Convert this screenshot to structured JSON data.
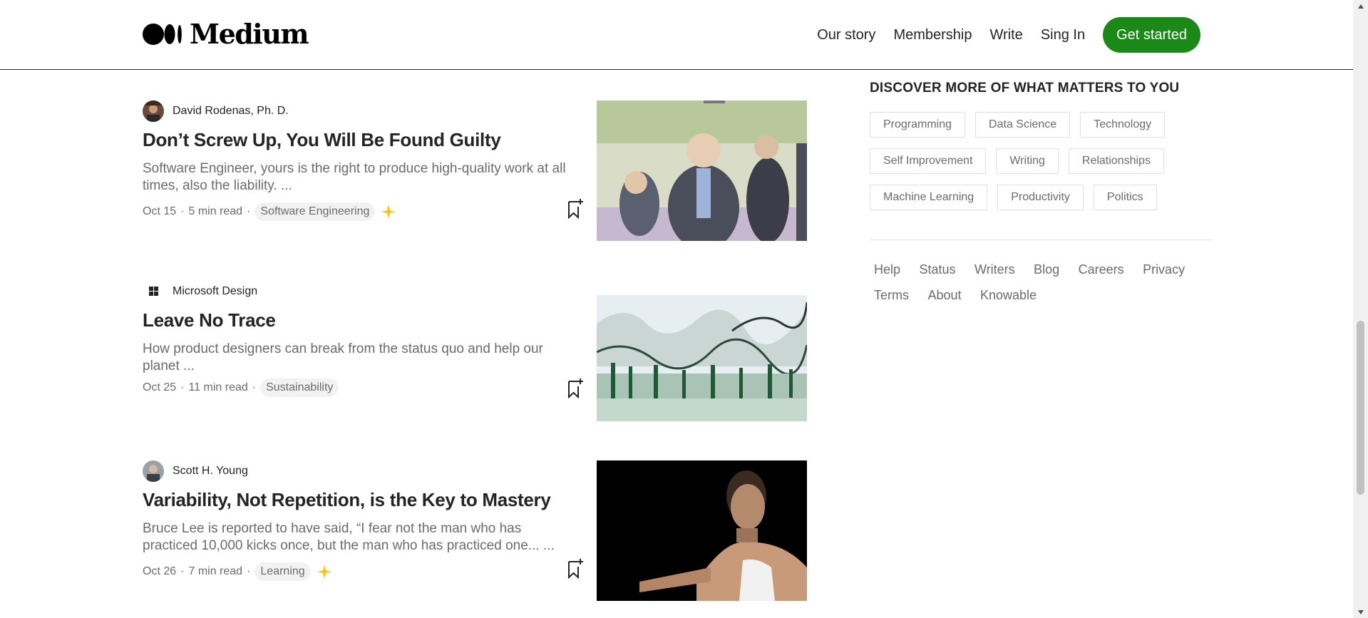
{
  "header": {
    "logo_text": "Medium",
    "nav": [
      "Our story",
      "Membership",
      "Write",
      "Sing In"
    ],
    "cta": "Get started"
  },
  "articles": [
    {
      "author": "David Rodenas, Ph. D.",
      "title": "Don’t Screw Up, You Will Be Found Guilty",
      "subtitle": "Software Engineer, yours is the right to produce high-quality work at all times, also the liability. ...",
      "date": "Oct 15",
      "read_time": "5 min read",
      "tag": "Software Engineering",
      "member_only": true
    },
    {
      "author": "Microsoft Design",
      "title": "Leave No Trace",
      "subtitle": "How product designers can break from the status quo and help our planet ...",
      "date": "Oct 25",
      "read_time": "11 min read",
      "tag": "Sustainability",
      "member_only": false
    },
    {
      "author": "Scott H. Young",
      "title": "Variability, Not Repetition, is the Key to Mastery",
      "subtitle": "Bruce Lee is reported to have said, “I fear not the man who has practiced 10,000 kicks once, but the man who has practiced one... ...",
      "date": "Oct 26",
      "read_time": "7 min read",
      "tag": "Learning",
      "member_only": true
    }
  ],
  "sidebar": {
    "heading": "DISCOVER MORE OF WHAT MATTERS TO YOU",
    "topics": [
      "Programming",
      "Data Science",
      "Technology",
      "Self Improvement",
      "Writing",
      "Relationships",
      "Machine Learning",
      "Productivity",
      "Politics"
    ],
    "footer_links": [
      "Help",
      "Status",
      "Writers",
      "Blog",
      "Careers",
      "Privacy",
      "Terms",
      "About",
      "Knowable"
    ]
  },
  "colors": {
    "accent": "#1a8917",
    "sparkle": "#ffc017",
    "text": "#242424",
    "muted": "#6b6b6b"
  }
}
